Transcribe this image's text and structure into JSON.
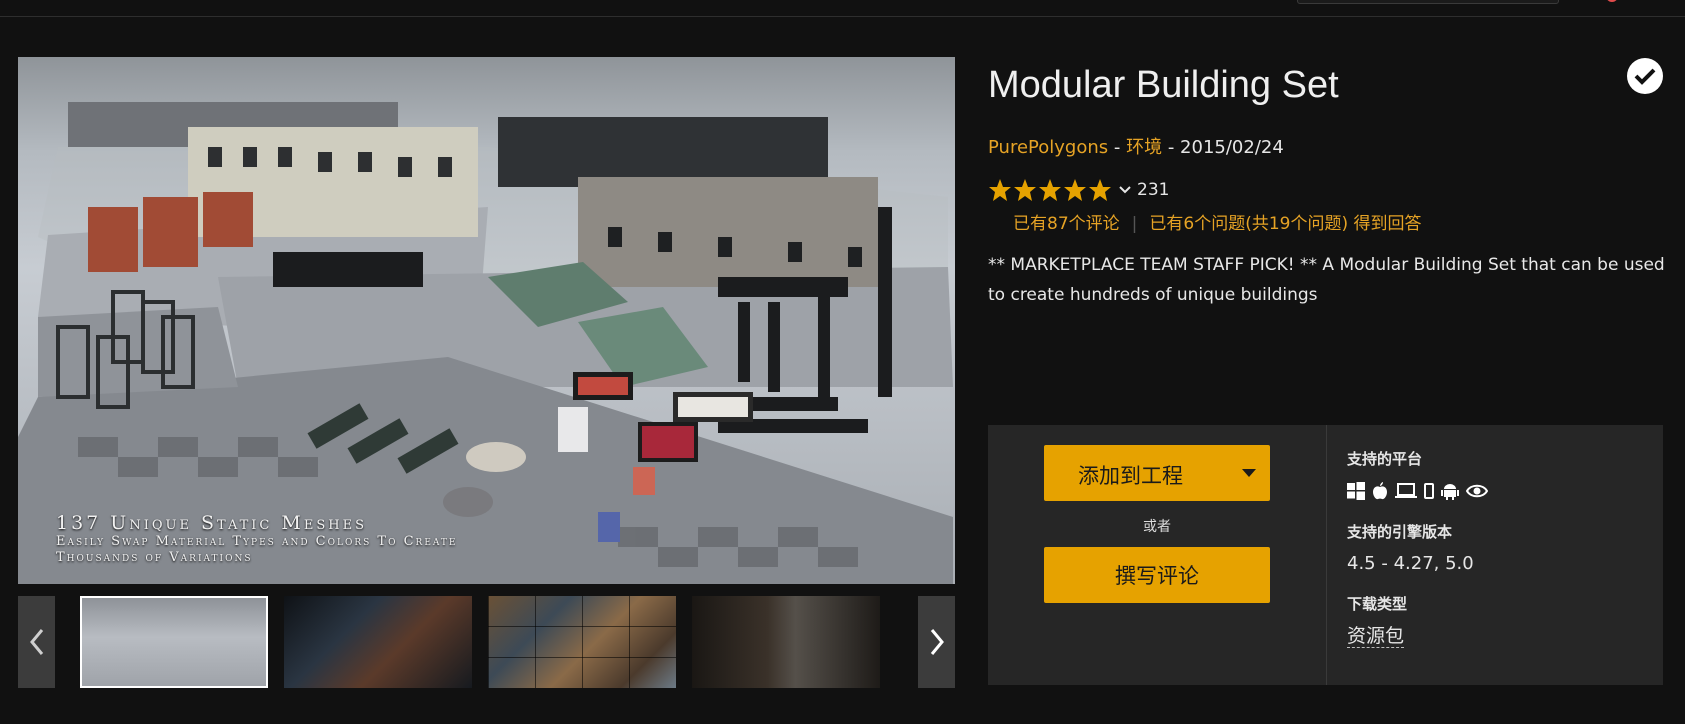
{
  "product": {
    "title": "Modular Building Set",
    "seller": "PurePolygons",
    "category": "环境",
    "date": "2015/02/24",
    "separator": " - ",
    "rating_count": "231",
    "rating_value_out_of_5": 5,
    "reviews_link": "已有87个评论",
    "questions_link": "已有6个问题(共19个问题) 得到回答",
    "description": "** MARKETPLACE TEAM STAFF PICK! ** A Modular Building Set that can be used to create hundreds of unique buildings"
  },
  "hero": {
    "caption_line1": "137 Unique Static Meshes",
    "caption_line2": "Easily Swap Material Types and Colors To Create",
    "caption_line3": "Thousands of Variations"
  },
  "gallery": {
    "selected_index": 0,
    "thumbnail_count": 4
  },
  "purchase": {
    "add_to_project_label": "添加到工程",
    "or_text": "或者",
    "write_review_label": "撰写评论"
  },
  "details": {
    "platforms_label": "支持的平台",
    "platform_icons": [
      "windows-icon",
      "apple-icon",
      "linux-laptop-icon",
      "mobile-icon",
      "android-icon",
      "vr-eye-icon"
    ],
    "engine_versions_label": "支持的引擎版本",
    "engine_versions": "4.5 - 4.27, 5.0",
    "download_type_label": "下载类型",
    "download_type": "资源包"
  },
  "colors": {
    "accent": "#e6a200",
    "link": "#e6a325",
    "background": "#111111",
    "panel": "#262626"
  }
}
